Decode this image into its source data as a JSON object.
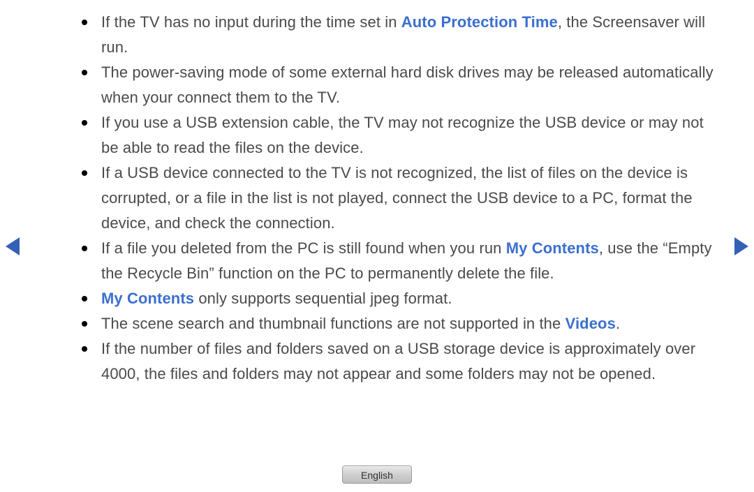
{
  "bullets": [
    {
      "segments": [
        {
          "text": "If the TV has no input during the time set in "
        },
        {
          "text": "Auto Protection Time",
          "highlight": true
        },
        {
          "text": ", the Screensaver will run."
        }
      ]
    },
    {
      "segments": [
        {
          "text": "The power-saving mode of some external hard disk drives may be released automatically when your connect them to the TV."
        }
      ]
    },
    {
      "segments": [
        {
          "text": "If you use a USB extension cable, the TV may not recognize the USB device or may not be able to read the files on the device."
        }
      ]
    },
    {
      "segments": [
        {
          "text": "If a USB device connected to the TV is not recognized, the list of files on the device is corrupted, or a file in the list is not played, connect the USB device to a PC, format the device, and check the connection."
        }
      ]
    },
    {
      "segments": [
        {
          "text": "If a file you deleted from the PC is still found when you run "
        },
        {
          "text": "My Contents",
          "highlight": true
        },
        {
          "text": ", use the “Empty the Recycle Bin” function on the PC to permanently delete the file."
        }
      ]
    },
    {
      "segments": [
        {
          "text": "My Contents",
          "highlight": true
        },
        {
          "text": " only supports sequential jpeg format."
        }
      ]
    },
    {
      "segments": [
        {
          "text": "The scene search and thumbnail functions are not supported in the "
        },
        {
          "text": "Videos",
          "highlight": true
        },
        {
          "text": "."
        }
      ]
    },
    {
      "segments": [
        {
          "text": "If the number of files and folders saved on a USB storage device is approximately over 4000, the files and folders may not appear and some folders may not be opened."
        }
      ]
    }
  ],
  "language_button": "English",
  "colors": {
    "highlight": "#3b6fcf",
    "arrow": "#3560b8"
  }
}
